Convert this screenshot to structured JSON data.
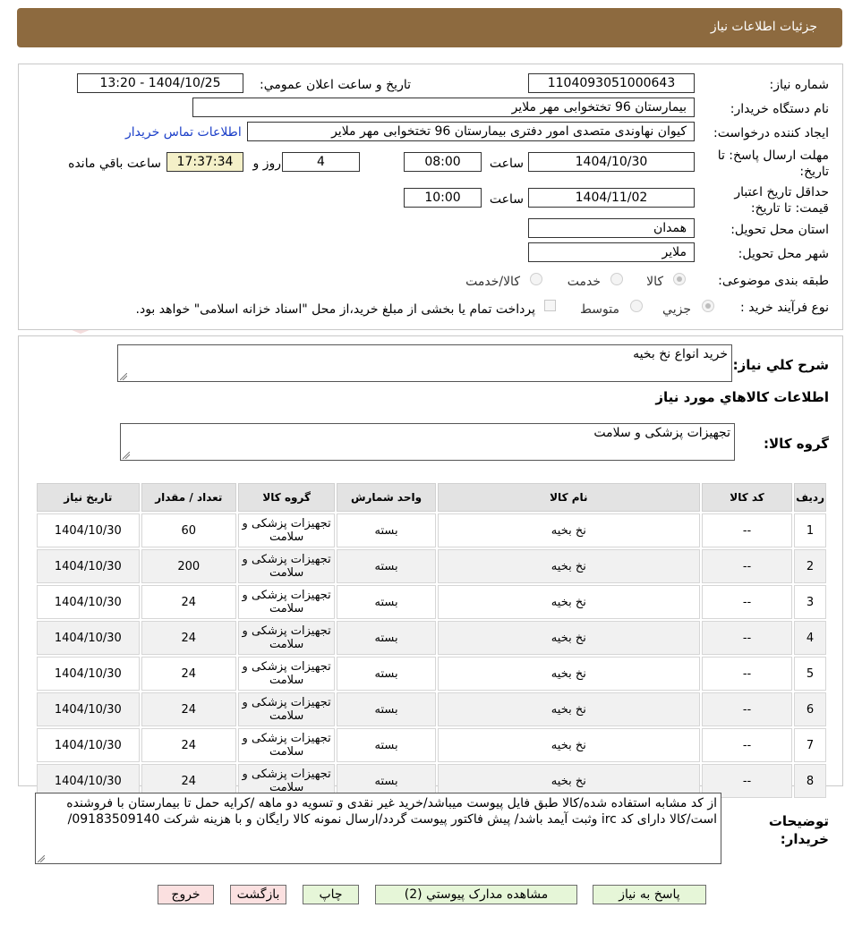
{
  "header": {
    "title": "جزئیات اطلاعات نیاز"
  },
  "form": {
    "need_number_label": "شماره نیاز:",
    "need_number": "1104093051000643",
    "announce_label": "تاریخ و ساعت اعلان عمومي:",
    "announce_value": "1404/10/25 - 13:20",
    "buyer_label": "نام دستگاه خریدار:",
    "buyer_value": "بیمارستان 96 تختخوابی مهر ملایر",
    "creator_label": "ایجاد کننده درخواست:",
    "creator_value": "کیوان نهاوندی متصدی امور دفتری بیمارستان 96 تختخوابی مهر ملایر",
    "contact_link": "اطلاعات تماس خریدار",
    "deadline_label": "مهلت ارسال پاسخ: تا تاریخ:",
    "deadline_date": "1404/10/30",
    "time_word": "ساعت",
    "deadline_time": "08:00",
    "days_value": "4",
    "days_word": "روز و",
    "remaining_time": "17:37:34",
    "remaining_word": "ساعت باقي مانده",
    "validity_label": "حداقل تاریخ اعتبار قیمت: تا تاریخ:",
    "validity_date": "1404/11/02",
    "validity_time": "10:00",
    "province_label": "استان محل تحویل:",
    "province_value": "همدان",
    "city_label": "شهر محل تحویل:",
    "city_value": "ملایر",
    "category_label": "طبقه بندی موضوعی:",
    "category_options": [
      "کالا",
      "خدمت",
      "کالا/خدمت"
    ],
    "category_selected": "کالا",
    "process_label": "نوع فرآیند خرید :",
    "process_options": [
      "جزیي",
      "متوسط"
    ],
    "process_selected": "جزیي",
    "treasury_note": "پرداخت تمام يا بخشی از مبلغ خرید،از محل \"اسناد خزانه اسلامی\" خواهد بود."
  },
  "summary": {
    "label": "شرح کلي نياز:",
    "value": "خرید انواع نخ بخیه",
    "goods_info_title": "اطلاعات کالاهاي مورد نياز",
    "group_label": "گروه کالا:",
    "group_value": "تجهیزات پزشکی و سلامت"
  },
  "table": {
    "headers": [
      "رديف",
      "کد کالا",
      "نام کالا",
      "واحد شمارش",
      "گروه کالا",
      "تعداد / مقدار",
      "تاريخ نياز"
    ],
    "rows": [
      {
        "idx": "1",
        "code": "--",
        "name": "نخ بخیه",
        "unit": "بسته",
        "group": "تجهیزات پزشکی و سلامت",
        "qty": "60",
        "date": "1404/10/30"
      },
      {
        "idx": "2",
        "code": "--",
        "name": "نخ بخیه",
        "unit": "بسته",
        "group": "تجهیزات پزشکی و سلامت",
        "qty": "200",
        "date": "1404/10/30"
      },
      {
        "idx": "3",
        "code": "--",
        "name": "نخ بخیه",
        "unit": "بسته",
        "group": "تجهیزات پزشکی و سلامت",
        "qty": "24",
        "date": "1404/10/30"
      },
      {
        "idx": "4",
        "code": "--",
        "name": "نخ بخیه",
        "unit": "بسته",
        "group": "تجهیزات پزشکی و سلامت",
        "qty": "24",
        "date": "1404/10/30"
      },
      {
        "idx": "5",
        "code": "--",
        "name": "نخ بخیه",
        "unit": "بسته",
        "group": "تجهیزات پزشکی و سلامت",
        "qty": "24",
        "date": "1404/10/30"
      },
      {
        "idx": "6",
        "code": "--",
        "name": "نخ بخیه",
        "unit": "بسته",
        "group": "تجهیزات پزشکی و سلامت",
        "qty": "24",
        "date": "1404/10/30"
      },
      {
        "idx": "7",
        "code": "--",
        "name": "نخ بخیه",
        "unit": "بسته",
        "group": "تجهیزات پزشکی و سلامت",
        "qty": "24",
        "date": "1404/10/30"
      },
      {
        "idx": "8",
        "code": "--",
        "name": "نخ بخیه",
        "unit": "بسته",
        "group": "تجهیزات پزشکی و سلامت",
        "qty": "24",
        "date": "1404/10/30"
      }
    ]
  },
  "notes": {
    "label": "توضيحات خريدار:",
    "value": "از کد مشابه استفاده شده/کالا طبق فایل پیوست  میباشد/خرید غیر نقدی و تسویه دو ماهه  /کرایه حمل تا بیمارستان با فروشنده است/کالا دارای کد irc  وثبت آیمد باشد/ پیش فاکتور پیوست گردد/ارسال نمونه کالا رایگان و با هزینه شرکت 09183509140/"
  },
  "buttons": {
    "reply": "پاسخ به نياز",
    "attachments": "مشاهده مدارک پيوستي (2)",
    "print": "چاپ",
    "back": "بازگشت",
    "exit": "خروج"
  },
  "watermark": {
    "text": "AriaTender.neT"
  },
  "colors": {
    "header_bg": "#8d6a3f",
    "link": "#1a3ec8",
    "remaining_bg": "#f4f0c8",
    "button_green": "#e6f6d8",
    "button_red": "#fbe0e0"
  }
}
